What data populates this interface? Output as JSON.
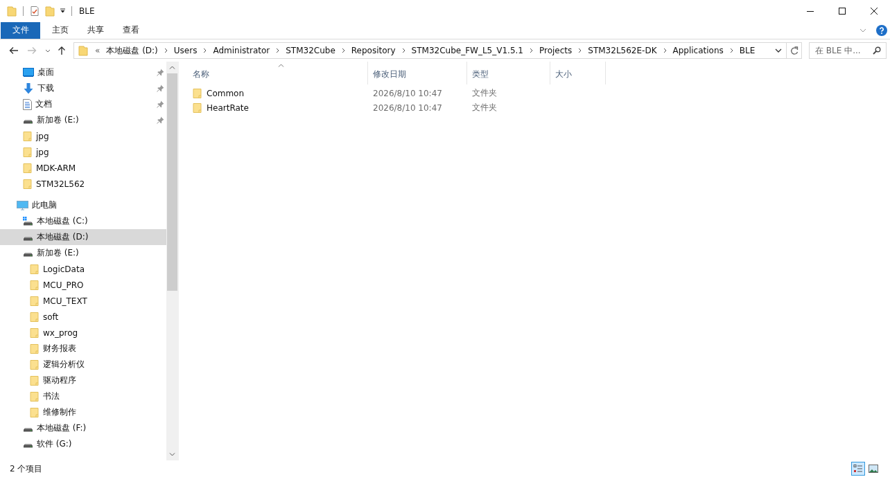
{
  "window": {
    "title": "BLE"
  },
  "ribbon_tabs": [
    {
      "label": "文件",
      "kind": "file"
    },
    {
      "label": "主页",
      "kind": "tab"
    },
    {
      "label": "共享",
      "kind": "tab"
    },
    {
      "label": "查看",
      "kind": "tab"
    }
  ],
  "address_bar": {
    "overflow": "«",
    "segments": [
      "本地磁盘 (D:)",
      "Users",
      "Administrator",
      "STM32Cube",
      "Repository",
      "STM32Cube_FW_L5_V1.5.1",
      "Projects",
      "STM32L562E-DK",
      "Applications",
      "BLE"
    ]
  },
  "search": {
    "placeholder": "在 BLE 中..."
  },
  "sidebar": {
    "quick_access": [
      {
        "label": "桌面",
        "kind": "desktop",
        "pinned": true,
        "selected": false
      },
      {
        "label": "下载",
        "kind": "download",
        "pinned": true,
        "selected": false
      },
      {
        "label": "文档",
        "kind": "document",
        "pinned": true,
        "selected": false
      },
      {
        "label": "新加卷 (E:)",
        "kind": "drive",
        "pinned": true,
        "selected": false
      },
      {
        "label": "jpg",
        "kind": "folder",
        "pinned": false,
        "selected": false
      },
      {
        "label": "jpg",
        "kind": "folder",
        "pinned": false,
        "selected": false
      },
      {
        "label": "MDK-ARM",
        "kind": "folder",
        "pinned": false,
        "selected": false
      },
      {
        "label": "STM32L562",
        "kind": "folder",
        "pinned": false,
        "selected": false
      }
    ],
    "tree": [
      {
        "label": "此电脑",
        "kind": "pc",
        "selected": false,
        "children": [
          {
            "label": "本地磁盘 (C:)",
            "kind": "system-drive",
            "selected": false
          },
          {
            "label": "本地磁盘 (D:)",
            "kind": "drive",
            "selected": true
          },
          {
            "label": "新加卷 (E:)",
            "kind": "drive",
            "selected": false,
            "children": [
              {
                "label": "LogicData",
                "kind": "folder",
                "selected": false
              },
              {
                "label": "MCU_PRO",
                "kind": "folder",
                "selected": false
              },
              {
                "label": "MCU_TEXT",
                "kind": "folder",
                "selected": false
              },
              {
                "label": "soft",
                "kind": "folder",
                "selected": false
              },
              {
                "label": "wx_prog",
                "kind": "folder",
                "selected": false
              },
              {
                "label": "财务报表",
                "kind": "folder",
                "selected": false
              },
              {
                "label": "逻辑分析仪",
                "kind": "folder",
                "selected": false
              },
              {
                "label": "驱动程序",
                "kind": "folder",
                "selected": false
              },
              {
                "label": "书法",
                "kind": "folder",
                "selected": false
              },
              {
                "label": "维修制作",
                "kind": "folder",
                "selected": false
              }
            ]
          },
          {
            "label": "本地磁盘 (F:)",
            "kind": "drive",
            "selected": false
          },
          {
            "label": "软件 (G:)",
            "kind": "drive",
            "selected": false
          }
        ]
      }
    ]
  },
  "table": {
    "columns": [
      {
        "label": "名称",
        "sorted": true
      },
      {
        "label": "修改日期",
        "sorted": false
      },
      {
        "label": "类型",
        "sorted": false
      },
      {
        "label": "大小",
        "sorted": false
      }
    ],
    "rows": [
      {
        "name": "Common",
        "modified": "2026/8/10 10:47",
        "type": "文件夹"
      },
      {
        "name": "HeartRate",
        "modified": "2026/8/10 10:47",
        "type": "文件夹"
      }
    ]
  },
  "status_bar": {
    "text": "2 个项目",
    "views": [
      {
        "kind": "details",
        "selected": true
      },
      {
        "kind": "large-icons",
        "selected": false
      }
    ]
  }
}
